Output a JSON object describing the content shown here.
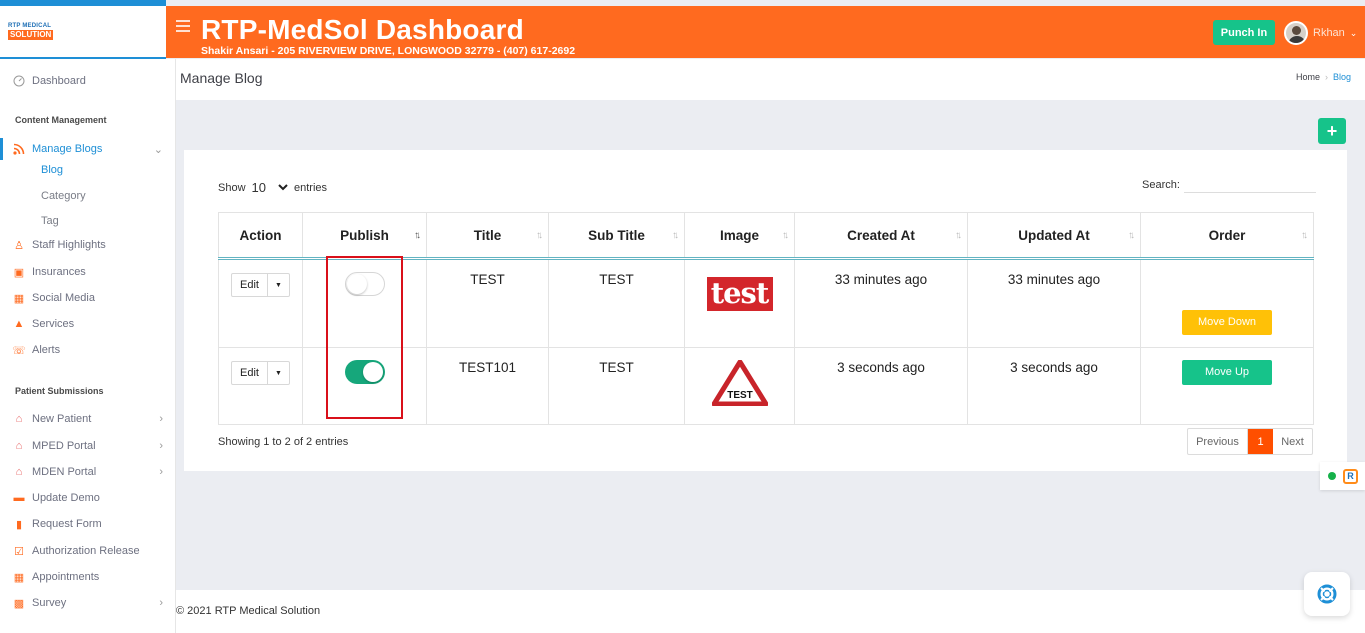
{
  "logo": {
    "line1": "RTP MEDICAL",
    "line2": "SOLUTION"
  },
  "header": {
    "title": "RTP-MedSol Dashboard",
    "subtitle": "Shakir Ansari - 205 RIVERVIEW DRIVE, LONGWOOD 32779 - (407) 617-2692",
    "punch_label": "Punch In",
    "user_name": "Rkhan",
    "brand_color": "#ff6a1f"
  },
  "sidebar": {
    "dashboard": "Dashboard",
    "section_content": "Content Management",
    "manage_blogs": "Manage Blogs",
    "blog_sub": [
      "Blog",
      "Category",
      "Tag"
    ],
    "content_items": [
      "Staff Highlights",
      "Insurances",
      "Social Media",
      "Services",
      "Alerts"
    ],
    "section_patient": "Patient Submissions",
    "patient_items": [
      "New Patient",
      "MPED Portal",
      "MDEN Portal",
      "Update Demo",
      "Request Form",
      "Authorization Release",
      "Appointments",
      "Survey"
    ]
  },
  "subheader": {
    "title": "Manage Blog",
    "crumb_home": "Home",
    "crumb_current": "Blog"
  },
  "table_controls": {
    "show": "Show",
    "entries_value": "10",
    "entries": "entries",
    "search": "Search:"
  },
  "table": {
    "columns": [
      "Action",
      "Publish",
      "Title",
      "Sub Title",
      "Image",
      "Created At",
      "Updated At",
      "Order"
    ],
    "rows": [
      {
        "action": "Edit",
        "published": false,
        "title": "TEST",
        "subtitle": "TEST",
        "image": "test-logo-red",
        "created": "33 minutes ago",
        "updated": "33 minutes ago",
        "order": "Move Down"
      },
      {
        "action": "Edit",
        "published": true,
        "title": "TEST101",
        "subtitle": "TEST",
        "image": "test-warning-triangle",
        "created": "3 seconds ago",
        "updated": "3 seconds ago",
        "order": "Move Up"
      }
    ],
    "logo_text": "test",
    "triangle_text": "TEST"
  },
  "pagination": {
    "info": "Showing 1 to 2 of 2 entries",
    "prev": "Previous",
    "page": "1",
    "next": "Next"
  },
  "footer": "© 2021 RTP Medical Solution",
  "widget": {
    "letter": "R"
  }
}
